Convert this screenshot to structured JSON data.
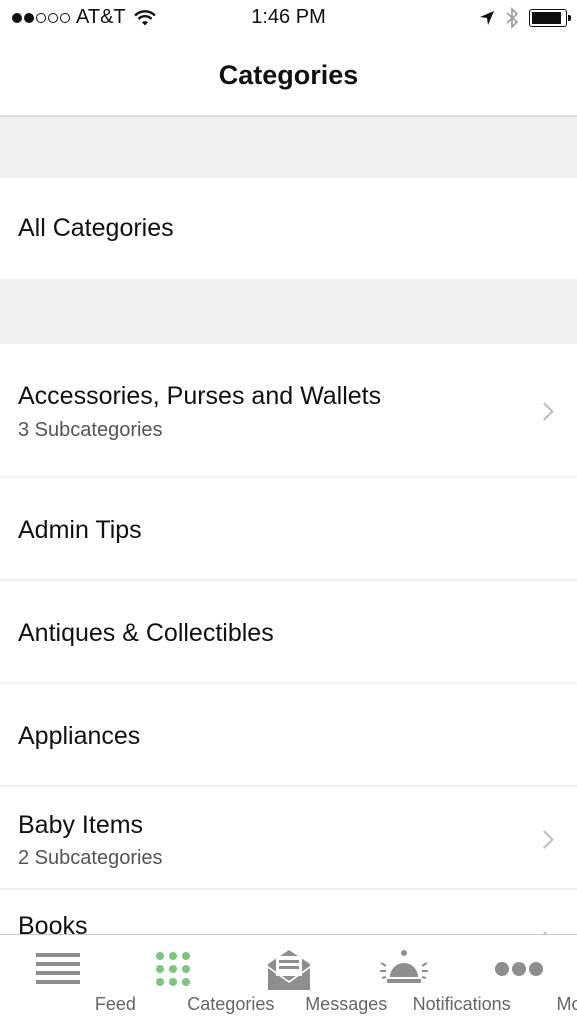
{
  "status_bar": {
    "signal_strength": "2 of 5",
    "carrier": "AT&T",
    "time": "1:46 PM",
    "battery_level": 0.9
  },
  "nav": {
    "title": "Categories"
  },
  "all_categories": {
    "label": "All Categories"
  },
  "categories": [
    {
      "title": "Accessories, Purses and Wallets",
      "subtitle": "3 Subcategories",
      "has_children": true
    },
    {
      "title": "Admin Tips",
      "subtitle": "",
      "has_children": false
    },
    {
      "title": "Antiques & Collectibles",
      "subtitle": "",
      "has_children": false
    },
    {
      "title": "Appliances",
      "subtitle": "",
      "has_children": false
    },
    {
      "title": "Baby Items",
      "subtitle": "2 Subcategories",
      "has_children": true
    },
    {
      "title": "Books",
      "subtitle": "",
      "has_children": true
    }
  ],
  "tabs": [
    {
      "label": "Feed",
      "icon": "feed-icon",
      "active": false
    },
    {
      "label": "Categories",
      "icon": "grid-icon",
      "active": true
    },
    {
      "label": "Messages",
      "icon": "envelope-icon",
      "active": false
    },
    {
      "label": "Notifications",
      "icon": "bell-icon",
      "active": false
    },
    {
      "label": "More",
      "icon": "more-icon",
      "active": false
    }
  ],
  "colors": {
    "active_tab": "#7ac67e",
    "inactive_tab": "#8e8e8e",
    "section_gap": "#f1f1f1"
  }
}
